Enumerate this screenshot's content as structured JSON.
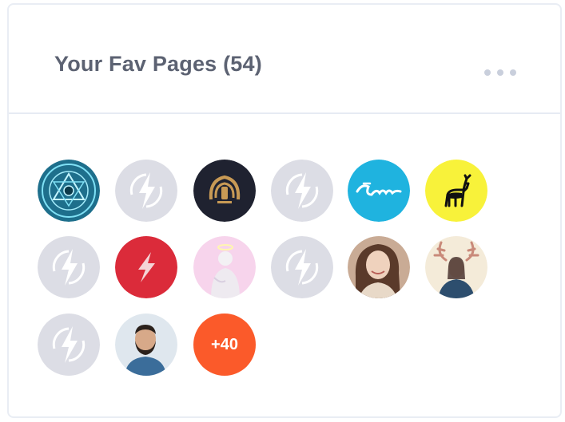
{
  "widget": {
    "title": "Your Fav Pages (54)",
    "more_icon": "more-horizontal-icon"
  },
  "pages": [
    {
      "name": "page-avatar-tech-logo",
      "icon": "tech-logo"
    },
    {
      "name": "page-avatar-placeholder",
      "icon": "placeholder-bolt"
    },
    {
      "name": "page-avatar-gold-emblem",
      "icon": "gold-emblem"
    },
    {
      "name": "page-avatar-placeholder",
      "icon": "placeholder-bolt"
    },
    {
      "name": "page-avatar-script-logo",
      "icon": "script-logo"
    },
    {
      "name": "page-avatar-deer-logo",
      "icon": "deer-logo"
    },
    {
      "name": "page-avatar-placeholder",
      "icon": "placeholder-bolt"
    },
    {
      "name": "page-avatar-lightning-logo",
      "icon": "lightning-logo"
    },
    {
      "name": "page-avatar-angel-statue",
      "icon": "angel-statue"
    },
    {
      "name": "page-avatar-placeholder",
      "icon": "placeholder-bolt"
    },
    {
      "name": "page-avatar-woman-photo",
      "icon": "woman-photo"
    },
    {
      "name": "page-avatar-antlers-photo",
      "icon": "antlers-photo"
    },
    {
      "name": "page-avatar-placeholder",
      "icon": "placeholder-bolt"
    },
    {
      "name": "page-avatar-man-photo",
      "icon": "man-photo"
    }
  ],
  "more_badge": {
    "label": "+40",
    "color": "#fb5a2a"
  },
  "colors": {
    "placeholder_bg": "#dcdde5",
    "cyan_logo_bg": "#1fb3df",
    "yellow_logo_bg": "#f8f23a",
    "red_logo_bg": "#db2b3a",
    "pink_logo_bg": "#f7d4ec",
    "dark_logo_bg": "#1f2230"
  }
}
